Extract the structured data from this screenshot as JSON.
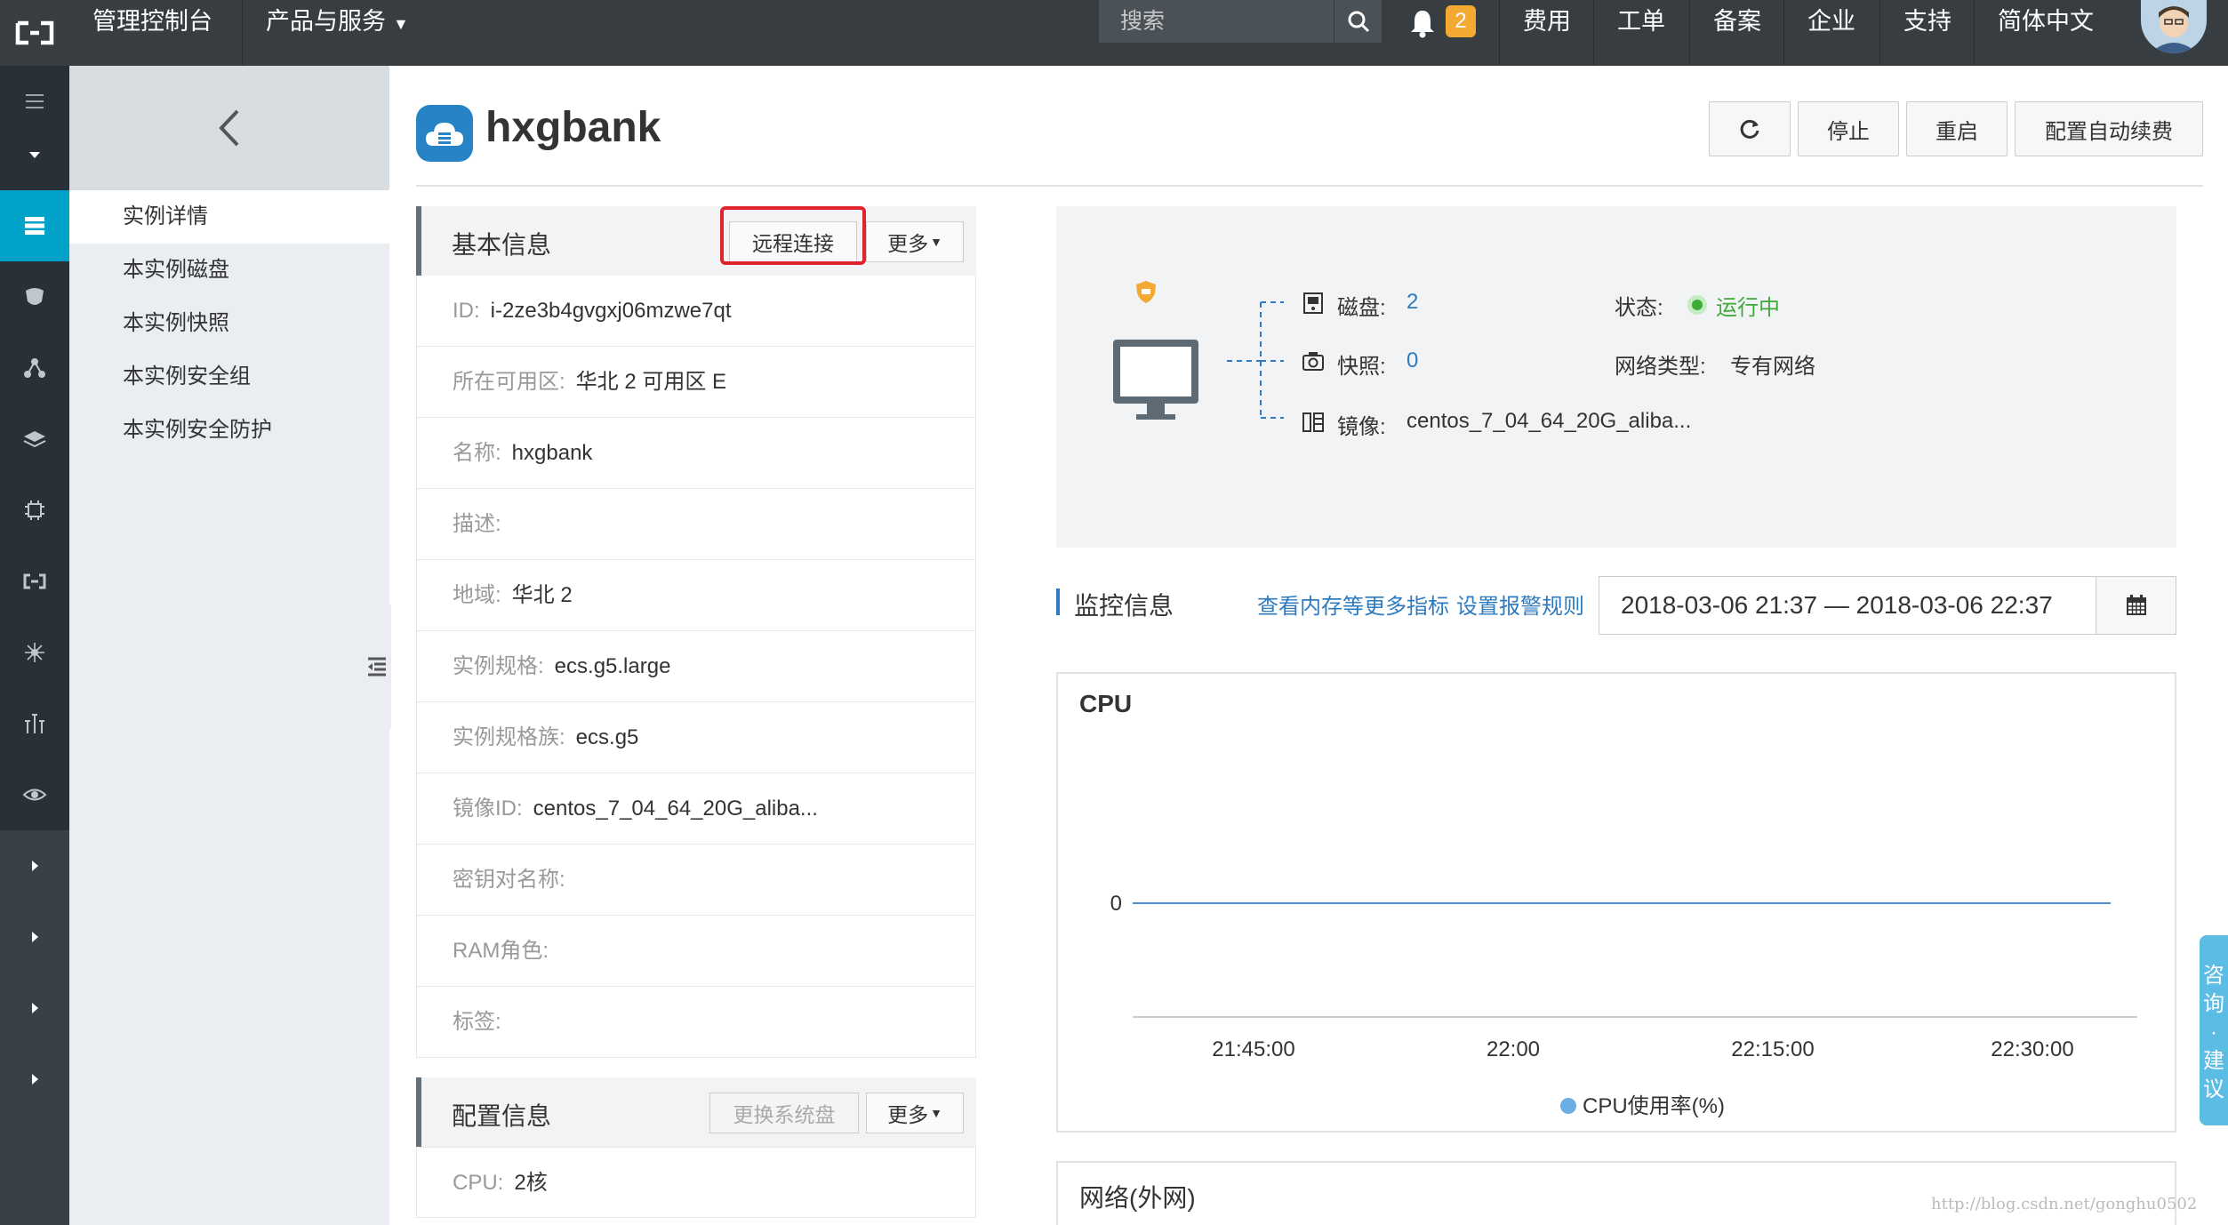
{
  "topbar": {
    "console": "管理控制台",
    "products": "产品与服务",
    "search_placeholder": "搜索",
    "notification_count": "2",
    "menu": [
      "费用",
      "工单",
      "备案",
      "企业",
      "支持",
      "简体中文"
    ]
  },
  "subnav": {
    "items": [
      "实例详情",
      "本实例磁盘",
      "本实例快照",
      "本实例安全组",
      "本实例安全防护"
    ]
  },
  "header": {
    "title": "hxgbank",
    "stop": "停止",
    "restart": "重启",
    "auto_renew": "配置自动续费"
  },
  "basic": {
    "title": "基本信息",
    "remote": "远程连接",
    "more": "更多",
    "rows": [
      {
        "k": "ID:",
        "v": "i-2ze3b4gvgxj06mzwe7qt"
      },
      {
        "k": "所在可用区:",
        "v": "华北 2 可用区 E"
      },
      {
        "k": "名称:",
        "v": "hxgbank"
      },
      {
        "k": "描述:",
        "v": ""
      },
      {
        "k": "地域:",
        "v": "华北 2"
      },
      {
        "k": "实例规格:",
        "v": "ecs.g5.large"
      },
      {
        "k": "实例规格族:",
        "v": "ecs.g5"
      },
      {
        "k": "镜像ID:",
        "v": "centos_7_04_64_20G_aliba..."
      },
      {
        "k": "密钥对名称:",
        "v": ""
      },
      {
        "k": "RAM角色:",
        "v": ""
      },
      {
        "k": "标签:",
        "v": ""
      }
    ]
  },
  "config": {
    "title": "配置信息",
    "change_disk": "更换系统盘",
    "more": "更多",
    "cpu_k": "CPU:",
    "cpu_v": "2核"
  },
  "overview": {
    "disk_k": "磁盘:",
    "disk_v": "2",
    "snapshot_k": "快照:",
    "snapshot_v": "0",
    "image_k": "镜像:",
    "image_v": "centos_7_04_64_20G_aliba...",
    "status_k": "状态:",
    "status_v": "运行中",
    "net_k": "网络类型:",
    "net_v": "专有网络"
  },
  "monitor": {
    "title": "监控信息",
    "link_more": "查看内存等更多指标",
    "link_alarm": "设置报警规则",
    "date_range": "2018-03-06 21:37  —  2018-03-06 22:37"
  },
  "chart_data": {
    "type": "line",
    "title": "CPU",
    "x": [
      "21:45:00",
      "22:00",
      "22:15:00",
      "22:30:00"
    ],
    "series": [
      {
        "name": "CPU使用率(%)",
        "values": [
          0,
          0,
          0,
          0
        ],
        "color": "#4a90d9"
      }
    ],
    "ylabel": "",
    "yticks": [
      "0"
    ],
    "legend": "bottom-center"
  },
  "network_card": {
    "title": "网络(外网)"
  },
  "side_consult": "咨询·建议",
  "watermark": "http://blog.csdn.net/gonghu0502"
}
